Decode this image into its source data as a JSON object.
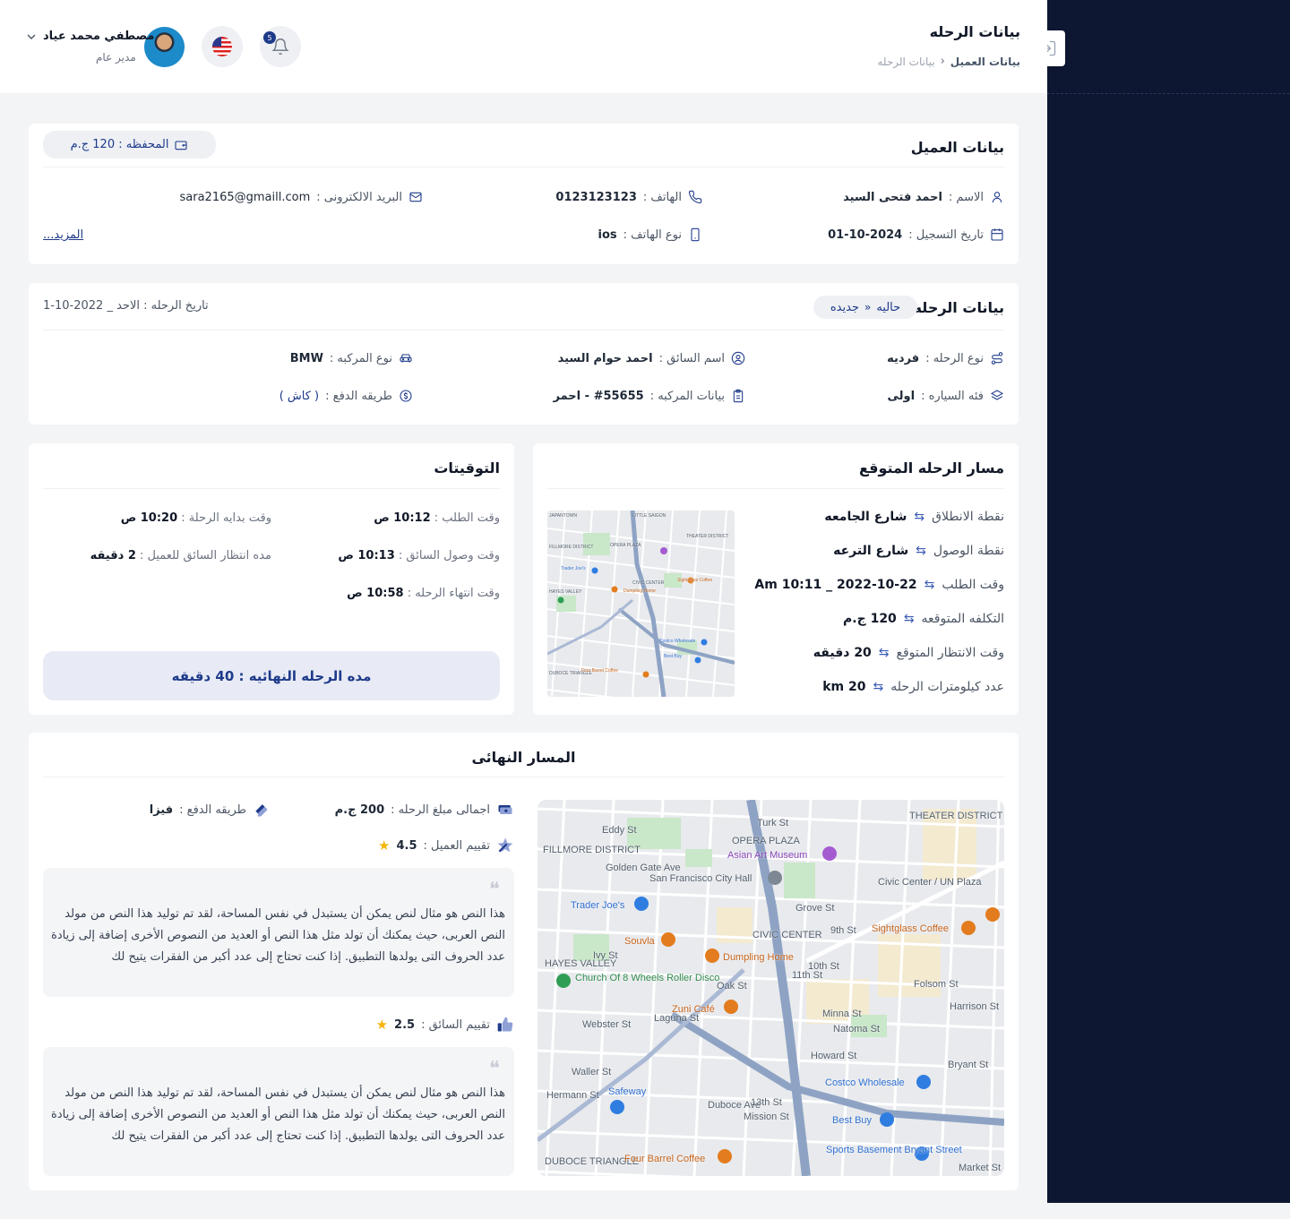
{
  "header": {
    "page_title": "بيانات الرحله",
    "breadcrumb": [
      "بيانات العميل",
      "بيانات الرحله"
    ],
    "notifications_count": "5",
    "user": {
      "name": "مصطفي محمد عياد",
      "role": "مدير عام"
    }
  },
  "client": {
    "title": "بيانات العميل",
    "wallet": "المحفظه : 120 ج.م",
    "name_label": "الاسم :",
    "name": "احمد فتحى السيد",
    "phone_label": "الهاتف :",
    "phone": "0123123123",
    "email_label": "البريد الالكترونى :",
    "email": "sara2165@gmaill.com",
    "reg_label": "تاريخ التسجيل :",
    "reg_date": "01-10-2024",
    "device_label": "نوع الهاتف :",
    "device": "ios",
    "more": "المزيد..."
  },
  "trip": {
    "title": "بيانات الرحله",
    "status_from": "حاليه",
    "status_to": "جديده",
    "date": "تاريخ الرحله : الاحد _ 2022-10-1",
    "type_label": "نوع الرحله :",
    "type": "فرديه",
    "driver_label": "اسم السائق :",
    "driver": "احمد حوام السيد",
    "vehicle_label": "نوع المركبه :",
    "vehicle": "BMW",
    "class_label": "فئه السياره :",
    "class": "اولى",
    "vehicle_info_label": "بيانات المركبه :",
    "vehicle_info": "#55655 - احمر",
    "payment_label": "طريقه الدفع :",
    "payment": "( كاش )"
  },
  "route": {
    "title": "مسار الرحله المتوقع",
    "rows": [
      {
        "label": "نقطة الانطلاق",
        "value": "شارع الجامعه"
      },
      {
        "label": "نقطة الوصول",
        "value": "شارع الترعه"
      },
      {
        "label": "وقت الطلب",
        "value": "2022-10-22 _ 10:11 Am"
      },
      {
        "label": "التكلفه المتوقعه",
        "value": "120 ج.م"
      },
      {
        "label": "وقت الانتظار المتوقع",
        "value": "20 دقيقه"
      },
      {
        "label": "عدد كيلومترات الرحله",
        "value": "20 km"
      }
    ]
  },
  "timings": {
    "title": "التوقيتات",
    "request_label": "وقت الطلب :",
    "request": "10:12 ص",
    "start_label": "وقت بدايه الرحلة :",
    "start": "10:20 ص",
    "arrive_label": "وقت وصول السائق :",
    "arrive": "10:13 ص",
    "wait_label": "مده انتظار السائق للعميل :",
    "wait": "2 دقيقه",
    "end_label": "وقت انتهاء الرحله :",
    "end": "10:58 ص",
    "total": "مده الرحله النهائيه : 40 دقيقه"
  },
  "final": {
    "title": "المسار النهائى",
    "amount_label": "اجمالى مبلغ الرحله :",
    "amount": "200 ج.م",
    "pay_label": "طريقه الدفع :",
    "pay": "فيزا",
    "client_rating_label": "تقييم العميل :",
    "client_rating": "4.5",
    "driver_rating_label": "تقييم السائق :",
    "driver_rating": "2.5",
    "review1": "هذا النص هو مثال لنص يمكن أن يستبدل في نفس المساحة، لقد تم توليد هذا النص من مولد النص العربى، حيث يمكنك أن تولد مثل هذا النص أو العديد من النصوص الأخرى إضافة إلى زيادة عدد الحروف التى يولدها التطبيق. إذا كنت تحتاج إلى عدد أكبر من الفقرات يتيح لك",
    "review2": "هذا النص هو مثال لنص يمكن أن يستبدل في نفس المساحة، لقد تم توليد هذا النص من مولد النص العربى، حيث يمكنك أن تولد مثل هذا النص أو العديد من النصوص الأخرى إضافة إلى زيادة عدد الحروف التى يولدها التطبيق. إذا كنت تحتاج إلى عدد أكبر من الفقرات يتيح لك"
  },
  "map_labels": {
    "small": [
      "JAPANTOWN",
      "LITTLE SAIGON",
      "THEATER DISTRICT",
      "OPERA PLAZA",
      "FILLMORE DISTRICT",
      "Trader Joe's",
      "CIVIC CENTER",
      "Sightglass Coffee",
      "HAYES VALLEY",
      "Dumpling Home",
      "Costco Wholesale",
      "Best Buy",
      "DUBOCE TRIANGLE",
      "Four Barrel Coffee"
    ],
    "large": [
      "THEATER DISTRICT",
      "OPERA PLAZA",
      "FILLMORE DISTRICT",
      "Golden Gate Ave",
      "Asian Art Museum",
      "San Francisco City Hall",
      "Civic Center / UN Plaza",
      "Trader Joe's",
      "CIVIC CENTER",
      "Sightglass Coffee",
      "Souvla",
      "Dumpling Home",
      "HAYES VALLEY",
      "Church Of 8 Wheels Roller Disco",
      "Oak St",
      "Zuni Café",
      "Costco Wholesale",
      "Safeway",
      "Duboce Ave",
      "Best Buy",
      "Sports Basement Bryant Street",
      "DUBOCE TRIANGLE",
      "Four Barrel Coffee",
      "Turk St",
      "Eddy St",
      "Grove St",
      "Ivy St",
      "Waller St",
      "Hermann St",
      "13th St",
      "Mission St",
      "Folsom St",
      "Harrison St",
      "Bryant St",
      "Howard St",
      "10th St",
      "9th St",
      "11th St",
      "Minna St",
      "Natoma St",
      "Laguna St",
      "Webster St",
      "Market St"
    ]
  },
  "colors": {
    "navy": "#1e3a8a",
    "sidebar": "#0d1731",
    "star": "#f5b50a"
  }
}
